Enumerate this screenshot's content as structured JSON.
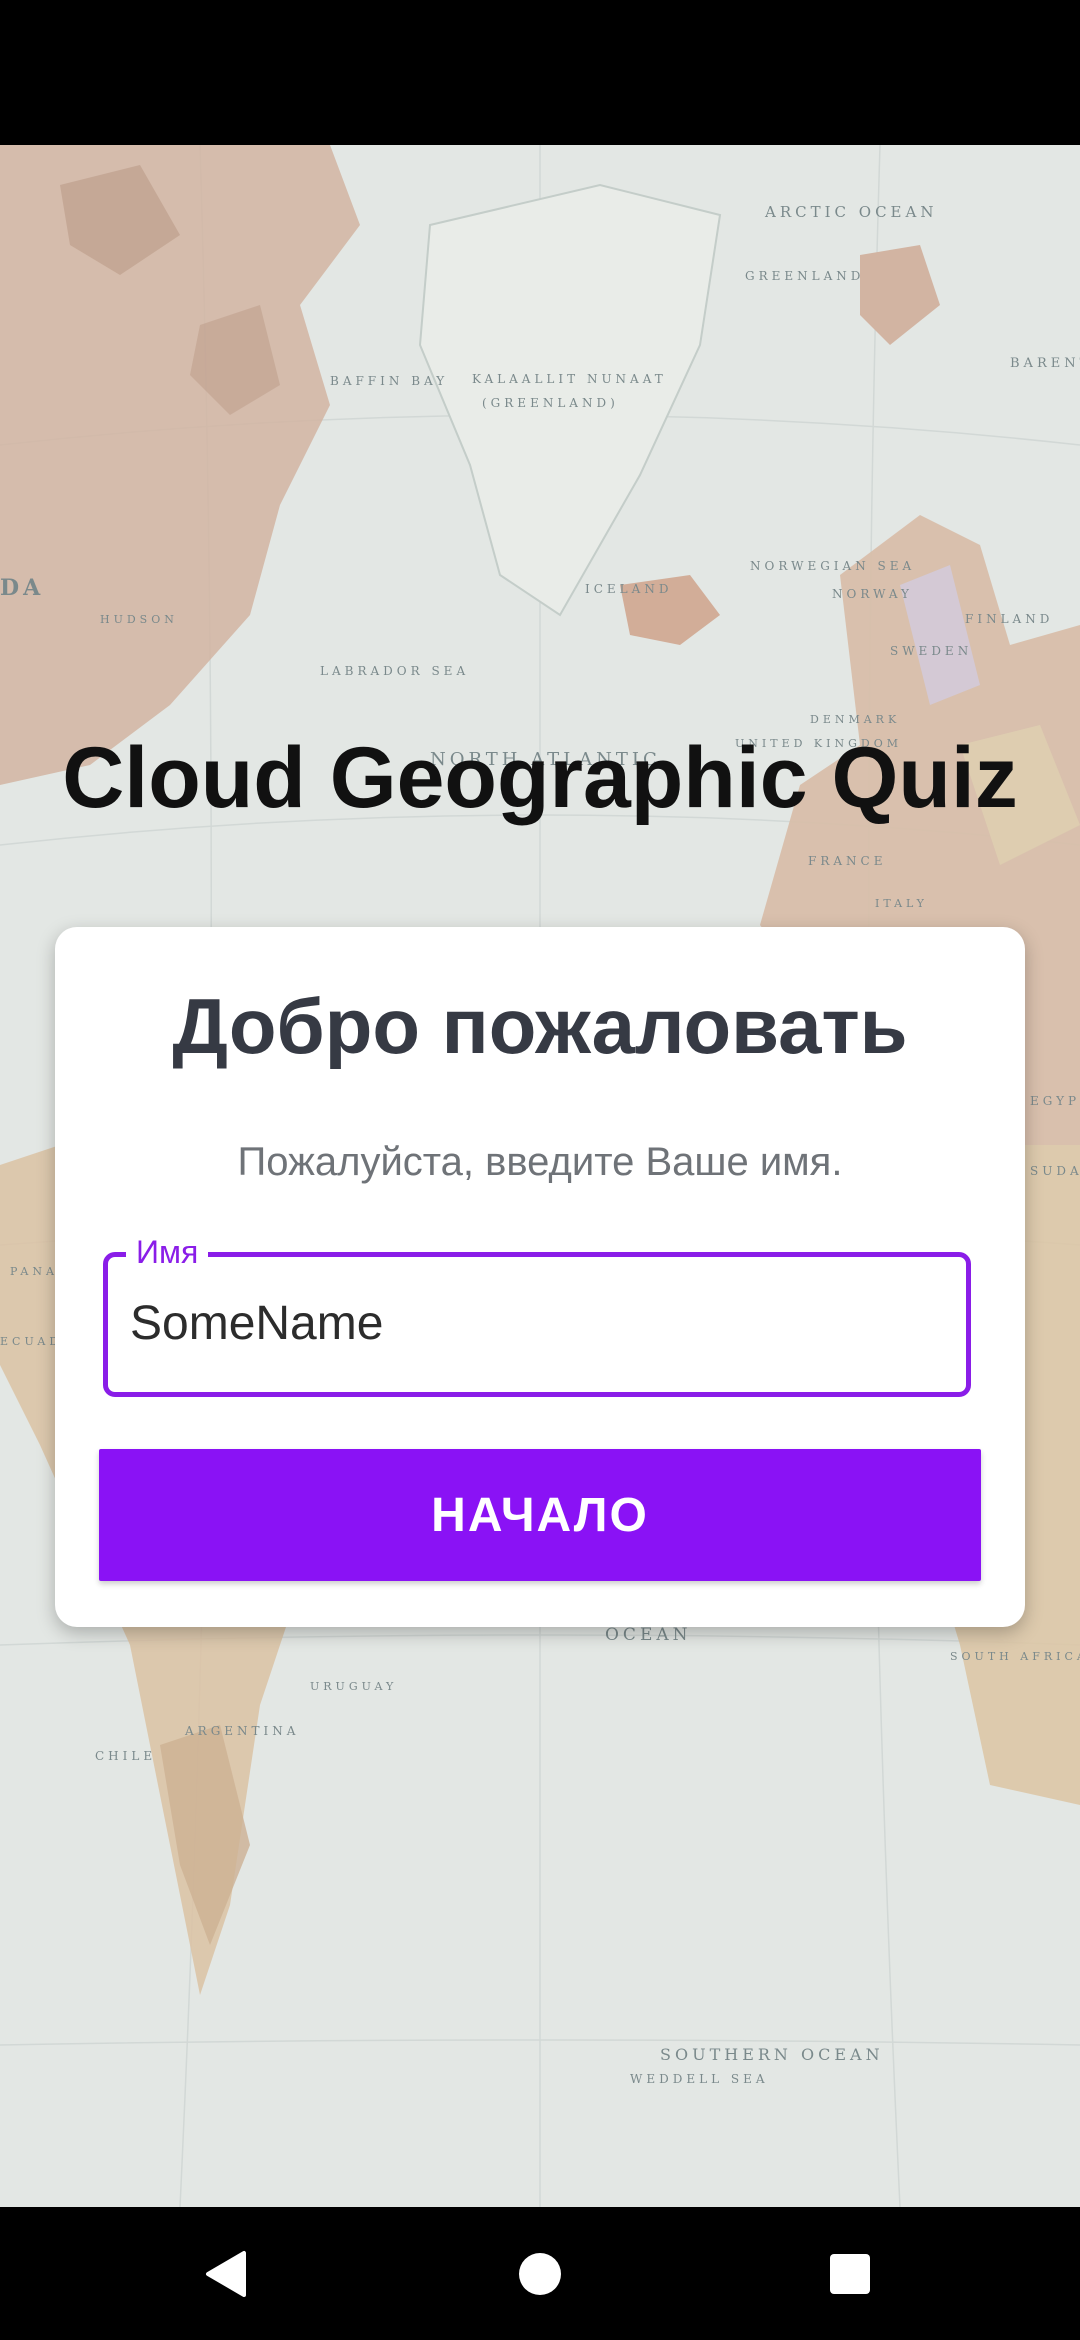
{
  "app": {
    "title": "Cloud Geographic Quiz"
  },
  "map": {
    "labels": {
      "arctic_ocean": "ARCTIC OCEAN",
      "greenland": "GREENLAND",
      "kalaallit": "KALAALLIT NUNAAT",
      "greenland_paren": "(GREENLAND)",
      "baffin_bay": "BAFFIN BAY",
      "labrador_sea": "LABRADOR SEA",
      "north_atlantic": "NORTH ATLANTIC",
      "norwegian_sea": "NORWEGIAN SEA",
      "iceland": "ICELAND",
      "norway": "NORWAY",
      "finland": "FINLAND",
      "sweden": "SWEDEN",
      "denmark": "DENMARK",
      "united_kingdom": "UNITED KINGDOM",
      "france": "FRANCE",
      "italy": "ITALY",
      "barents": "BARENTS",
      "hudson": "HUDSON",
      "egypt": "EGYPT",
      "sudan": "SUDAN",
      "ecuador": "ECUADOR",
      "panama": "PANAMA",
      "ocean": "OCEAN",
      "uruguay": "URUGUAY",
      "argentina": "ARGENTINA",
      "chile": "CHILE",
      "south_africa": "SOUTH AFRICA",
      "southern_ocean": "SOUTHERN OCEAN",
      "weddell_sea": "WEDDELL SEA",
      "da": "DA"
    }
  },
  "welcome_card": {
    "title": "Добро пожаловать",
    "subtitle": "Пожалуйста, введите Ваше имя.",
    "name_field": {
      "label": "Имя",
      "value": "SomeName"
    },
    "start_button": "НАЧАЛО"
  },
  "nav": {
    "back_icon": "back-triangle-icon",
    "home_icon": "home-circle-icon",
    "recents_icon": "recents-square-icon"
  },
  "colors": {
    "accent": "#8a12f5",
    "field_border": "#8a1de8",
    "land": "#c8a88f",
    "ocean": "#dfe3df"
  }
}
